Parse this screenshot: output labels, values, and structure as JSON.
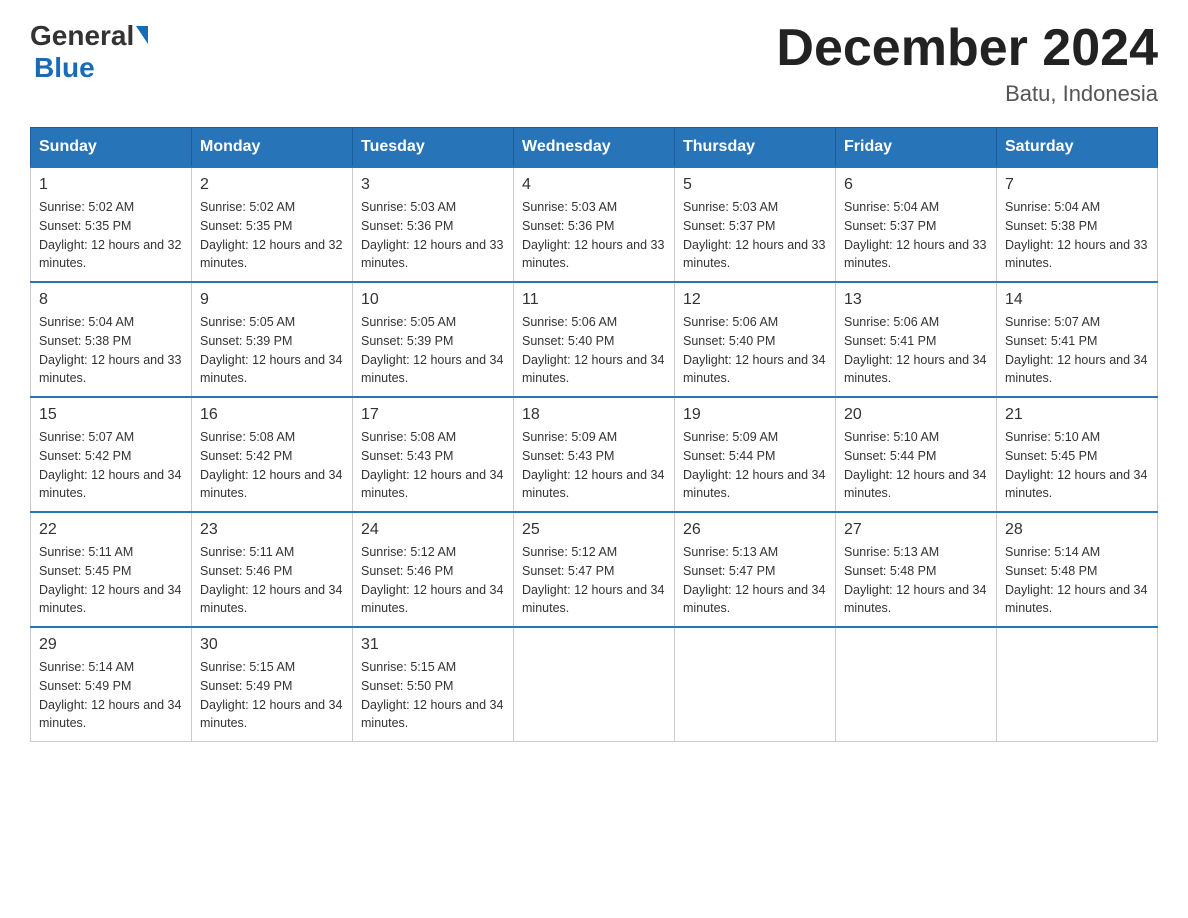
{
  "header": {
    "logo_general": "General",
    "logo_blue": "Blue",
    "month_title": "December 2024",
    "location": "Batu, Indonesia"
  },
  "weekdays": [
    "Sunday",
    "Monday",
    "Tuesday",
    "Wednesday",
    "Thursday",
    "Friday",
    "Saturday"
  ],
  "weeks": [
    [
      {
        "day": "1",
        "sunrise": "5:02 AM",
        "sunset": "5:35 PM",
        "daylight": "12 hours and 32 minutes."
      },
      {
        "day": "2",
        "sunrise": "5:02 AM",
        "sunset": "5:35 PM",
        "daylight": "12 hours and 32 minutes."
      },
      {
        "day": "3",
        "sunrise": "5:03 AM",
        "sunset": "5:36 PM",
        "daylight": "12 hours and 33 minutes."
      },
      {
        "day": "4",
        "sunrise": "5:03 AM",
        "sunset": "5:36 PM",
        "daylight": "12 hours and 33 minutes."
      },
      {
        "day": "5",
        "sunrise": "5:03 AM",
        "sunset": "5:37 PM",
        "daylight": "12 hours and 33 minutes."
      },
      {
        "day": "6",
        "sunrise": "5:04 AM",
        "sunset": "5:37 PM",
        "daylight": "12 hours and 33 minutes."
      },
      {
        "day": "7",
        "sunrise": "5:04 AM",
        "sunset": "5:38 PM",
        "daylight": "12 hours and 33 minutes."
      }
    ],
    [
      {
        "day": "8",
        "sunrise": "5:04 AM",
        "sunset": "5:38 PM",
        "daylight": "12 hours and 33 minutes."
      },
      {
        "day": "9",
        "sunrise": "5:05 AM",
        "sunset": "5:39 PM",
        "daylight": "12 hours and 34 minutes."
      },
      {
        "day": "10",
        "sunrise": "5:05 AM",
        "sunset": "5:39 PM",
        "daylight": "12 hours and 34 minutes."
      },
      {
        "day": "11",
        "sunrise": "5:06 AM",
        "sunset": "5:40 PM",
        "daylight": "12 hours and 34 minutes."
      },
      {
        "day": "12",
        "sunrise": "5:06 AM",
        "sunset": "5:40 PM",
        "daylight": "12 hours and 34 minutes."
      },
      {
        "day": "13",
        "sunrise": "5:06 AM",
        "sunset": "5:41 PM",
        "daylight": "12 hours and 34 minutes."
      },
      {
        "day": "14",
        "sunrise": "5:07 AM",
        "sunset": "5:41 PM",
        "daylight": "12 hours and 34 minutes."
      }
    ],
    [
      {
        "day": "15",
        "sunrise": "5:07 AM",
        "sunset": "5:42 PM",
        "daylight": "12 hours and 34 minutes."
      },
      {
        "day": "16",
        "sunrise": "5:08 AM",
        "sunset": "5:42 PM",
        "daylight": "12 hours and 34 minutes."
      },
      {
        "day": "17",
        "sunrise": "5:08 AM",
        "sunset": "5:43 PM",
        "daylight": "12 hours and 34 minutes."
      },
      {
        "day": "18",
        "sunrise": "5:09 AM",
        "sunset": "5:43 PM",
        "daylight": "12 hours and 34 minutes."
      },
      {
        "day": "19",
        "sunrise": "5:09 AM",
        "sunset": "5:44 PM",
        "daylight": "12 hours and 34 minutes."
      },
      {
        "day": "20",
        "sunrise": "5:10 AM",
        "sunset": "5:44 PM",
        "daylight": "12 hours and 34 minutes."
      },
      {
        "day": "21",
        "sunrise": "5:10 AM",
        "sunset": "5:45 PM",
        "daylight": "12 hours and 34 minutes."
      }
    ],
    [
      {
        "day": "22",
        "sunrise": "5:11 AM",
        "sunset": "5:45 PM",
        "daylight": "12 hours and 34 minutes."
      },
      {
        "day": "23",
        "sunrise": "5:11 AM",
        "sunset": "5:46 PM",
        "daylight": "12 hours and 34 minutes."
      },
      {
        "day": "24",
        "sunrise": "5:12 AM",
        "sunset": "5:46 PM",
        "daylight": "12 hours and 34 minutes."
      },
      {
        "day": "25",
        "sunrise": "5:12 AM",
        "sunset": "5:47 PM",
        "daylight": "12 hours and 34 minutes."
      },
      {
        "day": "26",
        "sunrise": "5:13 AM",
        "sunset": "5:47 PM",
        "daylight": "12 hours and 34 minutes."
      },
      {
        "day": "27",
        "sunrise": "5:13 AM",
        "sunset": "5:48 PM",
        "daylight": "12 hours and 34 minutes."
      },
      {
        "day": "28",
        "sunrise": "5:14 AM",
        "sunset": "5:48 PM",
        "daylight": "12 hours and 34 minutes."
      }
    ],
    [
      {
        "day": "29",
        "sunrise": "5:14 AM",
        "sunset": "5:49 PM",
        "daylight": "12 hours and 34 minutes."
      },
      {
        "day": "30",
        "sunrise": "5:15 AM",
        "sunset": "5:49 PM",
        "daylight": "12 hours and 34 minutes."
      },
      {
        "day": "31",
        "sunrise": "5:15 AM",
        "sunset": "5:50 PM",
        "daylight": "12 hours and 34 minutes."
      },
      null,
      null,
      null,
      null
    ]
  ]
}
